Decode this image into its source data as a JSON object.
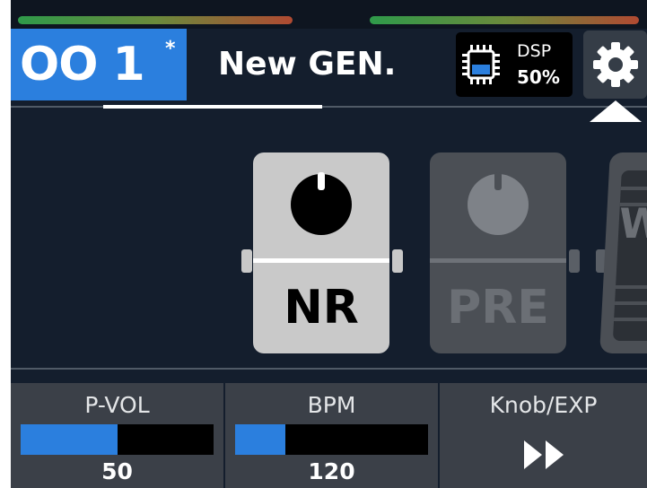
{
  "preset": {
    "number": "OO 1",
    "modified_marker": "*",
    "name": "New GEN."
  },
  "dsp": {
    "label": "DSP",
    "usage": "50%",
    "usage_fraction": 0.5
  },
  "settings": {
    "icon": "gear-icon"
  },
  "meters": {
    "colors": [
      "#2f9a4a",
      "#6a8a3c",
      "#b04a32"
    ]
  },
  "chain": {
    "blocks": [
      {
        "name": "NR",
        "state": "selected"
      },
      {
        "name": "PRE",
        "state": "inactive"
      },
      {
        "name": "W",
        "state": "inactive"
      }
    ]
  },
  "footer": {
    "params": [
      {
        "label": "P-VOL",
        "value": "50",
        "fill": 0.5
      },
      {
        "label": "BPM",
        "value": "120",
        "fill": 0.26
      },
      {
        "label": "Knob/EXP",
        "icon": "fast-forward-icon"
      }
    ]
  },
  "colors": {
    "accent": "#2b7fde",
    "background": "#141e2d",
    "panel": "#3b4048"
  }
}
